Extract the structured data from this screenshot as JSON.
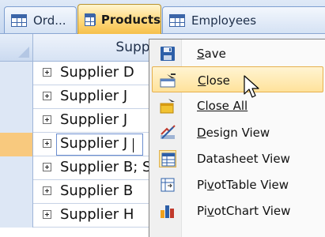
{
  "tabs": [
    {
      "label": "Ord...",
      "icon": "table-icon",
      "active": false
    },
    {
      "label": "Products",
      "icon": "table-icon",
      "active": true
    },
    {
      "label": "Employees",
      "icon": "table-icon",
      "active": false
    }
  ],
  "datasheet": {
    "column_header": "Suppli",
    "rows": [
      {
        "value": "Supplier D"
      },
      {
        "value": "Supplier J"
      },
      {
        "value": "Supplier J"
      },
      {
        "value": "Supplier J",
        "current": true
      },
      {
        "value": "Supplier B; S"
      },
      {
        "value": "Supplier B"
      },
      {
        "value": "Supplier H"
      }
    ]
  },
  "context_menu": {
    "items": [
      {
        "label": "Save",
        "icon": "save-disk-icon",
        "highlighted": false
      },
      {
        "label": "Close",
        "icon": "close-window-icon",
        "highlighted": true
      },
      {
        "label": "Close All",
        "icon": "close-all-icon",
        "highlighted": false
      },
      {
        "label": "Design View",
        "icon": "design-view-icon",
        "highlighted": false
      },
      {
        "label": "Datasheet View",
        "icon": "datasheet-view-icon",
        "highlighted": false
      },
      {
        "label": "PivotTable View",
        "icon": "pivottable-view-icon",
        "highlighted": false
      },
      {
        "label": "PivotChart View",
        "icon": "pivotchart-view-icon",
        "highlighted": false
      }
    ]
  },
  "colors": {
    "active_tab": "#ffd87a",
    "menu_highlight": "#ffe29b",
    "selected_row_marker": "#f8c97e"
  }
}
